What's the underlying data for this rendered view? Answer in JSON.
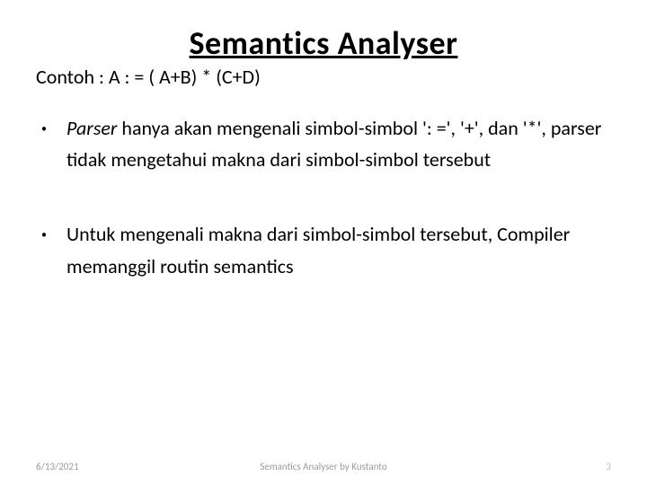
{
  "title": "Semantics Analyser",
  "subtitle": "Contoh :  A : = ( A+B) * (C+D)",
  "bullets": [
    {
      "lead": "Parser",
      "rest": "  hanya akan mengenali simbol-simbol ': =', '+', dan '*', parser tidak mengetahui makna dari simbol-simbol tersebut"
    },
    {
      "lead": "",
      "rest": "Untuk mengenali makna dari simbol-simbol tersebut, Compiler memanggil routin semantics"
    }
  ],
  "footer": {
    "date": "6/13/2021",
    "center": "Semantics Analyser by Kustanto",
    "page": "3"
  }
}
